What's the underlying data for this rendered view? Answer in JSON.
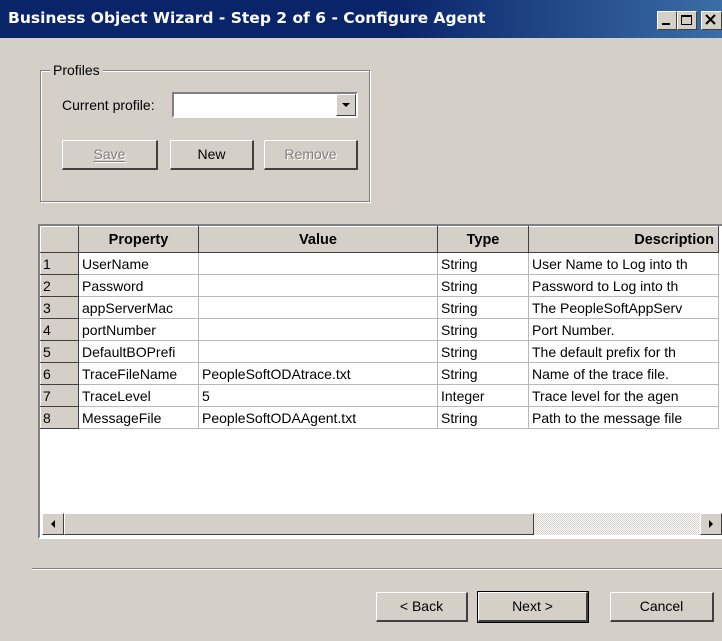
{
  "window": {
    "title": "Business Object Wizard - Step 2 of 6 - Configure Agent"
  },
  "profiles": {
    "group_label": "Profiles",
    "current_profile_label": "Current profile:",
    "current_profile_value": "",
    "save_label": "Save",
    "new_label": "New",
    "remove_label": "Remove"
  },
  "grid": {
    "columns": [
      "",
      "Property",
      "Value",
      "Type",
      "Description"
    ],
    "rows": [
      {
        "num": "1",
        "property": "UserName",
        "value": "",
        "type": "String",
        "description": "User Name to Log into th"
      },
      {
        "num": "2",
        "property": "Password",
        "value": "",
        "type": "String",
        "description": "Password to Log into th"
      },
      {
        "num": "3",
        "property": "appServerMac",
        "value": "",
        "type": "String",
        "description": "The PeopleSoftAppServ"
      },
      {
        "num": "4",
        "property": "portNumber",
        "value": "",
        "type": "String",
        "description": "Port Number."
      },
      {
        "num": "5",
        "property": "DefaultBOPrefi",
        "value": "",
        "type": "String",
        "description": "The default prefix for th"
      },
      {
        "num": "6",
        "property": "TraceFileName",
        "value": "PeopleSoftODAtrace.txt",
        "type": "String",
        "description": "Name of the trace file."
      },
      {
        "num": "7",
        "property": "TraceLevel",
        "value": "5",
        "type": "Integer",
        "description": "Trace level for the agen"
      },
      {
        "num": "8",
        "property": "MessageFile",
        "value": "PeopleSoftODAAgent.txt",
        "type": "String",
        "description": "Path to the message file"
      }
    ]
  },
  "footer": {
    "back_label": "< Back",
    "next_label": "Next >",
    "cancel_label": "Cancel"
  },
  "colors": {
    "titlebar": "#0a246a",
    "face": "#d4d0c8"
  }
}
